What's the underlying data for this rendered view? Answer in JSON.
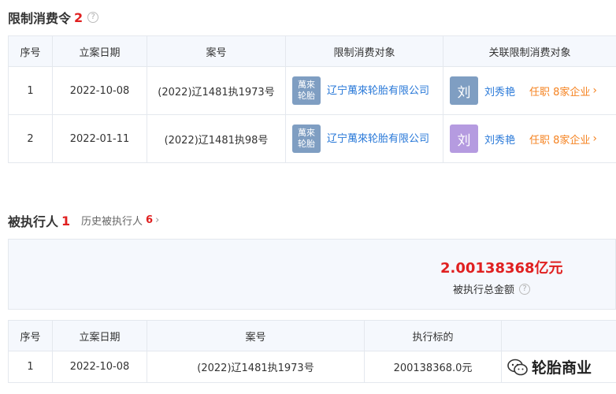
{
  "section1": {
    "title": "限制消费令",
    "count": "2",
    "help": "?",
    "headers": [
      "序号",
      "立案日期",
      "案号",
      "限制消费对象",
      "关联限制消费对象"
    ],
    "rows": [
      {
        "index": "1",
        "date": "2022-10-08",
        "case_no": "(2022)辽1481执1973号",
        "logo_line1": "萬來",
        "logo_line2": "轮胎",
        "company": "辽宁萬來轮胎有限公司",
        "avatar_char": "刘",
        "avatar_color": "#7f9ec2",
        "person": "刘秀艳",
        "job": "任职 8家企业"
      },
      {
        "index": "2",
        "date": "2022-01-11",
        "case_no": "(2022)辽1481执98号",
        "logo_line1": "萬來",
        "logo_line2": "轮胎",
        "company": "辽宁萬來轮胎有限公司",
        "avatar_char": "刘",
        "avatar_color": "#b59be0",
        "person": "刘秀艳",
        "job": "任职 8家企业"
      }
    ]
  },
  "section2": {
    "title": "被执行人",
    "count": "1",
    "history_label": "历史被执行人",
    "history_count": "6",
    "total_amount": "2.00138368亿元",
    "total_label": "被执行总金额",
    "help": "?",
    "headers": [
      "序号",
      "立案日期",
      "案号",
      "执行标的",
      ""
    ],
    "rows": [
      {
        "index": "1",
        "date": "2022-10-08",
        "case_no": "(2022)辽1481执1973号",
        "target": "200138368.0元"
      }
    ]
  },
  "watermark": {
    "text": "轮胎商业",
    "icon": "wechat-icon"
  },
  "colors": {
    "accent_red": "#e02020",
    "link_blue": "#2878d8",
    "orange": "#f5821f",
    "header_bg": "#f5f8fd"
  }
}
